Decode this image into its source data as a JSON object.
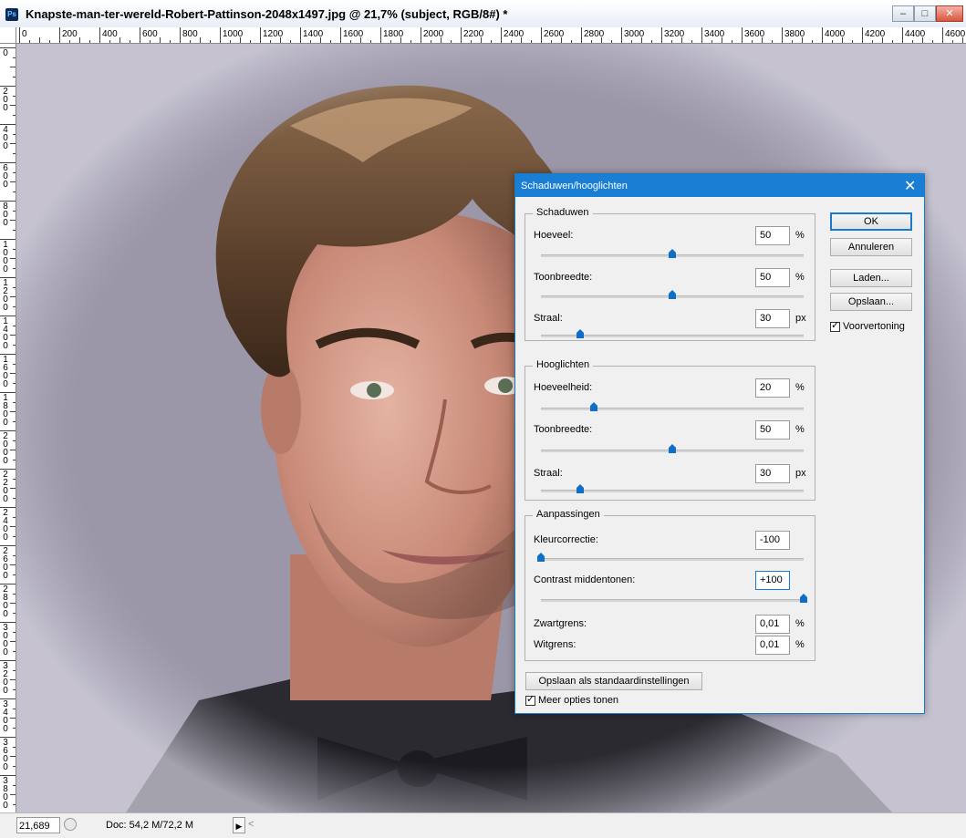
{
  "window": {
    "title": "Knapste-man-ter-wereld-Robert-Pattinson-2048x1497.jpg @ 21,7% (subject, RGB/8#) *",
    "app_icon": "Ps",
    "controls": {
      "minimize": "–",
      "maximize": "□",
      "close": "✕"
    }
  },
  "rulers": {
    "horizontal": [
      "0",
      "200",
      "400",
      "600",
      "800",
      "1000",
      "1200",
      "1400",
      "1600",
      "1800",
      "2000",
      "2200",
      "2400",
      "2600",
      "2800",
      "3000",
      "3200",
      "3400",
      "3600",
      "3800",
      "4000",
      "4200",
      "4400",
      "4600"
    ],
    "vertical": [
      "0",
      "200",
      "400",
      "600",
      "800",
      "1000",
      "1200",
      "1400",
      "1600",
      "1800",
      "2000",
      "2200",
      "2400",
      "2600",
      "2800",
      "3000",
      "3200",
      "3400",
      "3600",
      "3800",
      "4000"
    ]
  },
  "status": {
    "zoom": "21,689",
    "doc_size": "Doc: 54,2 M/72,2 M",
    "arrow": "▶",
    "scroll_left": "<"
  },
  "dialog": {
    "title": "Schaduwen/hooglichten",
    "close": "✕",
    "shadows": {
      "legend": "Schaduwen",
      "amount_label": "Hoeveel:",
      "amount_value": "50",
      "amount_unit": "%",
      "tonal_label": "Toonbreedte:",
      "tonal_value": "50",
      "tonal_unit": "%",
      "radius_label": "Straal:",
      "radius_value": "30",
      "radius_unit": "px",
      "amount_level": 0.5,
      "tonal_level": 0.5,
      "radius_level": 0.15
    },
    "highlights": {
      "legend": "Hooglichten",
      "amount_label": "Hoeveelheid:",
      "amount_value": "20",
      "amount_unit": "%",
      "tonal_label": "Toonbreedte:",
      "tonal_value": "50",
      "tonal_unit": "%",
      "radius_label": "Straal:",
      "radius_value": "30",
      "radius_unit": "px",
      "amount_level": 0.2,
      "tonal_level": 0.5,
      "radius_level": 0.15
    },
    "adjustments": {
      "legend": "Aanpassingen",
      "color_label": "Kleurcorrectie:",
      "color_value": "-100",
      "contrast_label": "Contrast middentonen:",
      "contrast_value": "+100",
      "black_label": "Zwartgrens:",
      "black_value": "0,01",
      "black_unit": "%",
      "white_label": "Witgrens:",
      "white_value": "0,01",
      "white_unit": "%",
      "color_level": 0.0,
      "contrast_level": 1.0
    },
    "buttons": {
      "ok": "OK",
      "cancel": "Annuleren",
      "load": "Laden...",
      "save": "Opslaan...",
      "save_defaults": "Opslaan als standaardinstellingen"
    },
    "preview_label": "Voorvertoning",
    "more_options_label": "Meer opties tonen"
  },
  "colors": {
    "accent": "#1a7fd4",
    "slider_thumb": "#0f6ec8",
    "canvas_bg": "#9b97a8"
  }
}
